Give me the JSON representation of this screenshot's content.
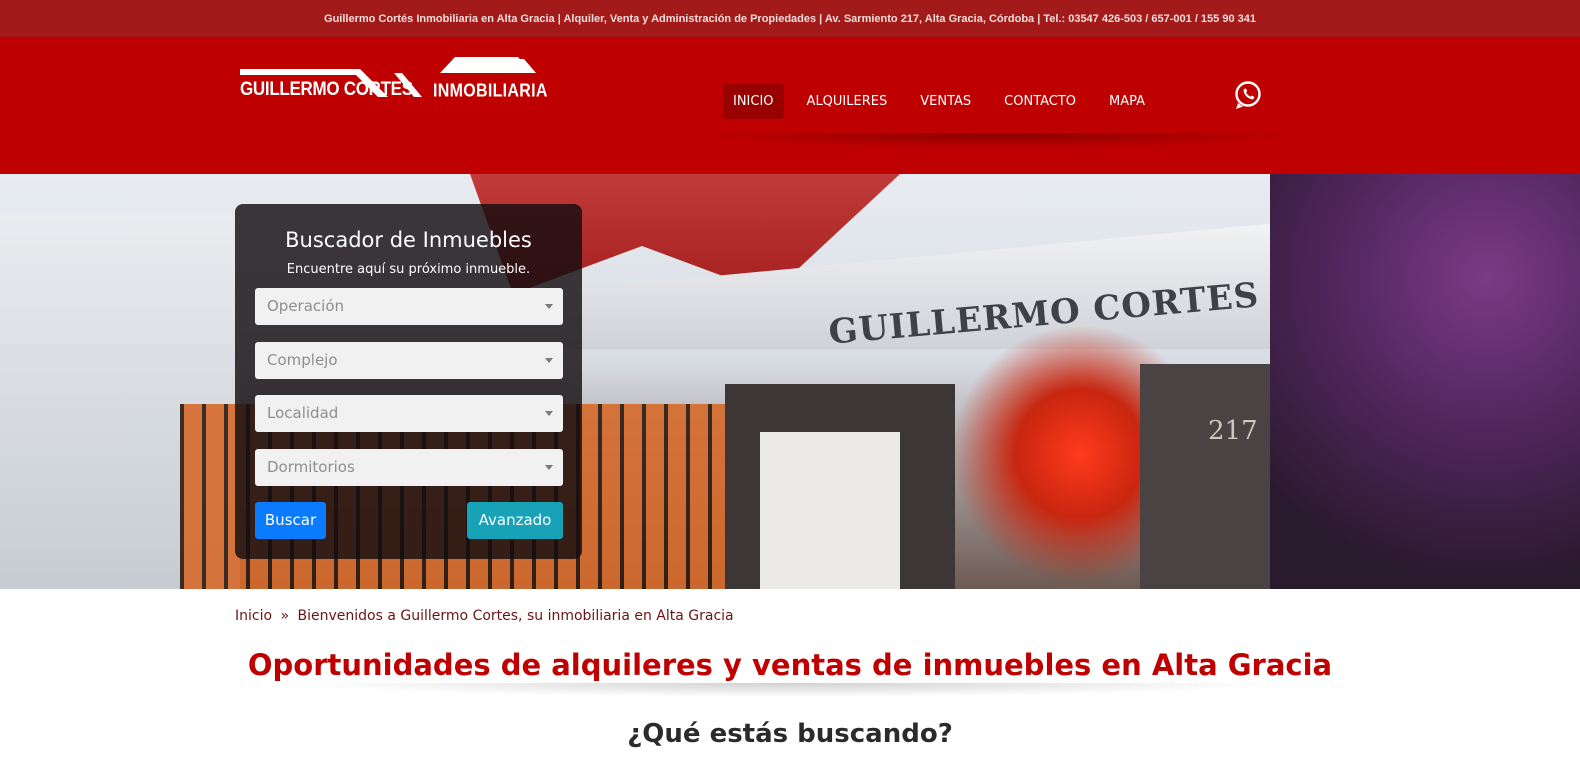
{
  "topbar": {
    "text": "Guillermo Cortés Inmobiliaria en Alta Gracia | Alquiler, Venta y Administración de Propiedades | Av. Sarmiento 217, Alta Gracia, Córdoba | Tel.: 03547 426-503 / 657-001 / 155 90 341"
  },
  "logo": {
    "name": "GUILLERMO CORTES",
    "subtitle": "INMOBILIARIA"
  },
  "nav": {
    "items": [
      {
        "label": "INICIO",
        "active": true
      },
      {
        "label": "ALQUILERES"
      },
      {
        "label": "VENTAS"
      },
      {
        "label": "CONTACTO"
      },
      {
        "label": "MAPA"
      }
    ],
    "whatsapp_icon": "whatsapp-icon"
  },
  "hero": {
    "sign": "GUILLERMO CORTES",
    "number": "217"
  },
  "search": {
    "title": "Buscador de Inmuebles",
    "subtitle": "Encuentre aquí su próximo inmueble.",
    "operacion": "Operación",
    "complejo": "Complejo",
    "localidad": "Localidad",
    "dormitorios": "Dormitorios",
    "buscar": "Buscar",
    "avanzado": "Avanzado"
  },
  "breadcrumb": {
    "home": "Inicio",
    "separator": "»",
    "current": "Bienvenidos a Guillermo Cortes, su inmobiliaria en Alta Gracia"
  },
  "main": {
    "title": "Oportunidades de alquileres y ventas de inmuebles en Alta Gracia",
    "question": "¿Qué estás buscando?"
  },
  "colors": {
    "header": "#bf0000",
    "topbar": "#a31a1a",
    "title": "#c00000",
    "buscar": "#0a7bff",
    "avanzado": "#17a2b8"
  }
}
